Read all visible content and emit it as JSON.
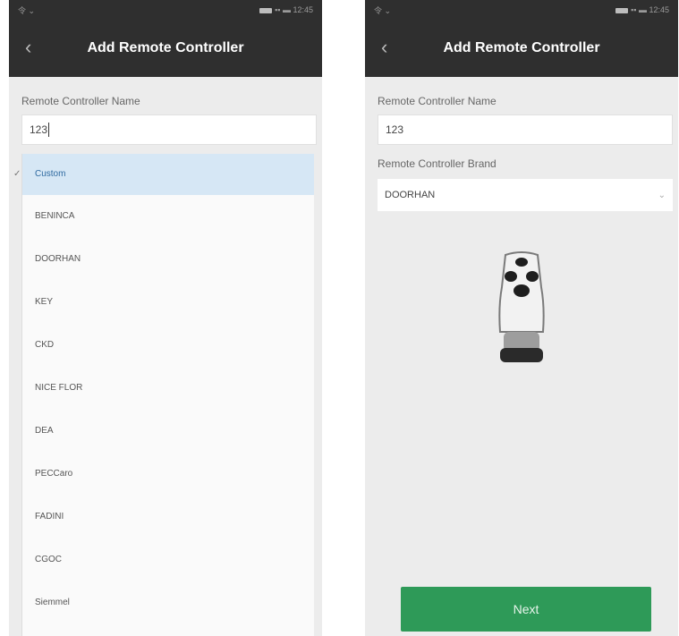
{
  "left": {
    "status": {
      "left": "令 ⌄",
      "right": "▪▪ ▬ 12:45"
    },
    "title": "Add Remote Controller",
    "name_label": "Remote Controller Name",
    "name_value": "123",
    "dropdown": [
      "Custom",
      "BENINCA",
      "DOORHAN",
      "KEY",
      "CKD",
      "NICE FLOR",
      "DEA",
      "PECCaro",
      "FADINI",
      "CGOC",
      "Siemmel"
    ]
  },
  "right": {
    "status": {
      "left": "令 ⌄",
      "right": "▪▪ ▬ 12:45"
    },
    "title": "Add Remote Controller",
    "name_label": "Remote Controller Name",
    "name_value": "123",
    "brand_label": "Remote Controller Brand",
    "brand_value": "DOORHAN",
    "next_label": "Next"
  },
  "icons": {
    "back": "back-arrow-icon",
    "chevron": "chevron-down-icon",
    "check": "check-icon",
    "battery": "battery-icon",
    "remote": "remote-control-image"
  },
  "colors": {
    "header_bg": "#2f2f2f",
    "selected_row": "#d6e7f5",
    "next_button": "#2e9a58",
    "screen_bg": "#ececec"
  }
}
